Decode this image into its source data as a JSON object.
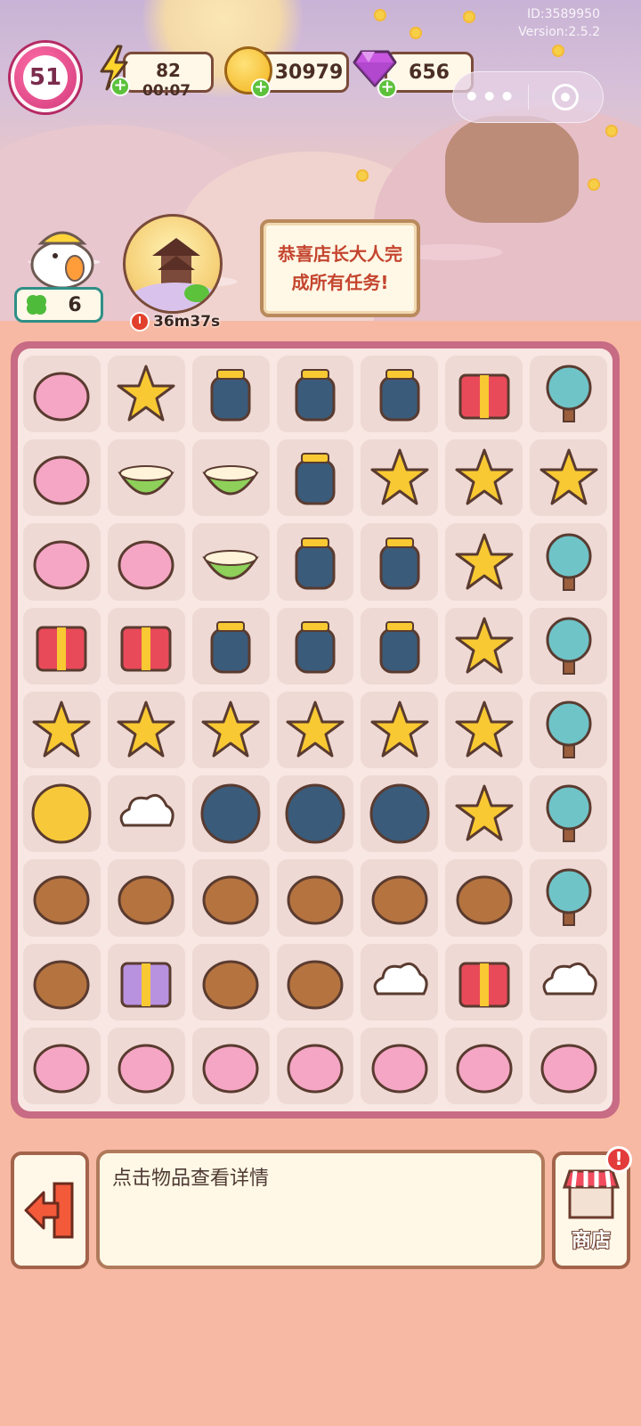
{
  "watermark": {
    "id": "ID:3589950",
    "version": "Version:2.5.2"
  },
  "hud": {
    "level": "51",
    "energy": {
      "value": "82",
      "timer": "00:07",
      "icon": "lightning-bolt-icon"
    },
    "coins": {
      "value": "30979",
      "icon": "gold-coin-icon"
    },
    "gems": {
      "value": "656",
      "icon": "purple-gem-icon"
    },
    "capsule": {
      "menu_icon": "more-dots-icon",
      "close_icon": "target-circle-icon"
    }
  },
  "workers": {
    "count": "6",
    "icon": "clover-icon"
  },
  "event": {
    "timer": "36m37s",
    "icon": "moon-pagoda-icon"
  },
  "notice": {
    "text": "恭喜店长大人完成所有任务!"
  },
  "board": {
    "rows": [
      [
        "rabbit-pounding-bowl",
        "blue-teapot-star",
        "blue-jar-red-seal",
        "blue-jar",
        "blue-cup",
        "golden-lantern-box",
        "moon-pavilion"
      ],
      [
        "rabbit-basket",
        "jelly-cake",
        "green-tea-bowl",
        "green-tea-cup",
        "osmanthus-soup",
        "star-treasure-table",
        "osmanthus-tree-big"
      ],
      [
        "rabbit-blue-bowl",
        "rabbit-pudding",
        "peach-cake",
        "wine-bottle-set",
        "glass-teacup",
        "star-basket",
        "moon-tree"
      ],
      [
        "red-pot-stove",
        "orange-gift-boxes",
        "jar-trio",
        "jam-jar-duo",
        "small-bottle",
        "star-plate",
        "blue-bonsai"
      ],
      [
        "osmanthus-basket",
        "osmanthus-branch",
        "osmanthus-flowers",
        "osmanthus-flower",
        "osmanthus-petal",
        "two-stars",
        "blue-small-tree"
      ],
      [
        "full-moon",
        "crescent-cloud",
        "half-moon",
        "gibbous-moon",
        "new-moon-cloud",
        "star",
        "sapling"
      ],
      [
        "wood-scoop",
        "bread-rabbits",
        "pig-bun",
        "acorn-pile",
        "acorn",
        "branch",
        "sprout"
      ],
      [
        "loom",
        "purple-cloth",
        "thread-spools",
        "spindle",
        "cloud",
        "gift-box",
        "seed"
      ],
      [
        "cloud-rabbit-dress",
        "pink-bow-outfit",
        "mirror-set",
        "pink-shoes",
        "pink-veil",
        "pink-ribbon",
        "green-rabbit-jelly"
      ]
    ]
  },
  "bottom": {
    "info_text": "点击物品查看详情",
    "shop_label": "商店",
    "shop_badge": "!",
    "exit_icon": "exit-arrow-icon",
    "shop_icon": "shop-awning-icon"
  },
  "colors": {
    "background": "#f7b9a3",
    "board_frame": "#c86b85",
    "board_fill": "#f8e7e2",
    "cell": "#efd9d4",
    "notice_text": "#c4452f",
    "badge": "#d2397a"
  }
}
